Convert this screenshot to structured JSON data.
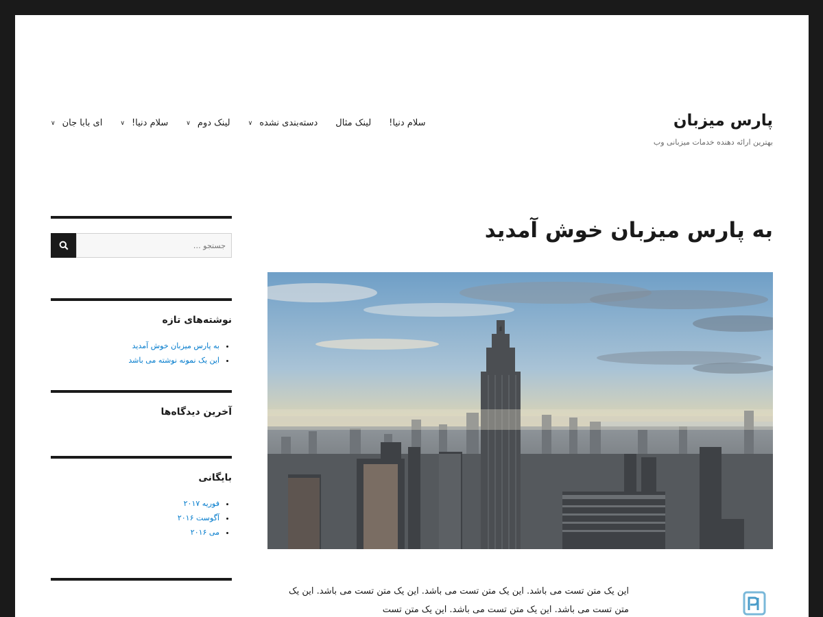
{
  "site": {
    "title": "پارس میزبان",
    "description": "بهترین ارائه دهنده خدمات میزبانی وب"
  },
  "nav": {
    "items": [
      {
        "label": "سلام دنیا!",
        "has_submenu": false
      },
      {
        "label": "لینک مثال",
        "has_submenu": false
      },
      {
        "label": "دسته‌بندی نشده",
        "has_submenu": true
      },
      {
        "label": "لینک دوم",
        "has_submenu": true
      },
      {
        "label": "سلام دنیا!",
        "has_submenu": true
      },
      {
        "label": "ای بابا جان",
        "has_submenu": true
      }
    ]
  },
  "post": {
    "title": "به پارس میزبان خوش آمدید",
    "excerpt": "این یک متن تست می باشد. این یک متن تست می باشد. این یک متن تست می باشد. این یک متن تست می باشد. این یک متن تست می باشد. این یک متن تست"
  },
  "sidebar": {
    "search": {
      "placeholder": "جستجو …",
      "button_icon": "search-icon"
    },
    "recent_posts": {
      "title": "نوشته‌های تازه",
      "items": [
        "به پارس میزبان خوش آمدید",
        "این یک نمونه نوشته می باشد"
      ]
    },
    "recent_comments": {
      "title": "آخرین دیدگاه‌ها"
    },
    "archives": {
      "title": "بایگانی",
      "items": [
        "فوریه ۲۰۱۷",
        "آگوست ۲۰۱۶",
        "می ۲۰۱۶"
      ]
    }
  },
  "colors": {
    "frame": "#1a1a1a",
    "text": "#1a1a1a",
    "link": "#007acc",
    "muted": "#686868"
  }
}
